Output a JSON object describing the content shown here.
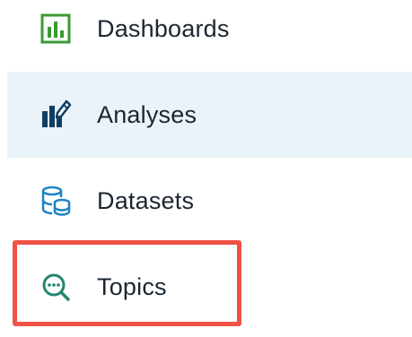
{
  "nav": {
    "items": [
      {
        "label": "Dashboards",
        "icon": "dashboard-icon",
        "selected": false
      },
      {
        "label": "Analyses",
        "icon": "analyses-icon",
        "selected": true
      },
      {
        "label": "Datasets",
        "icon": "datasets-icon",
        "selected": false
      },
      {
        "label": "Topics",
        "icon": "topics-icon",
        "selected": false,
        "highlighted": true
      }
    ]
  },
  "colors": {
    "selected_background": "#eaf3f9",
    "highlight_border": "#ef5146",
    "label_text": "#1b2631",
    "dashboard_icon_green": "#3a9a31",
    "analyses_icon_navy": "#0f3e63",
    "datasets_icon_blue": "#1f82c5",
    "topics_icon_teal": "#23876f"
  }
}
